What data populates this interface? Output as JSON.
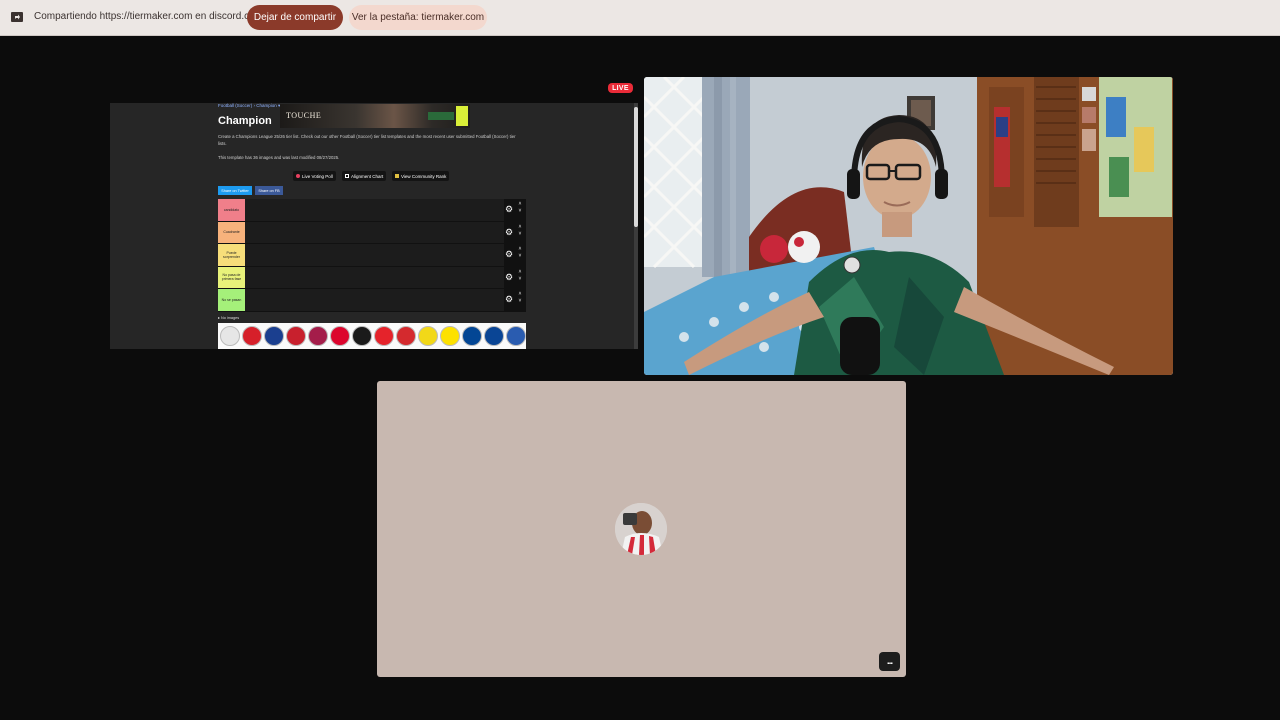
{
  "share_bar": {
    "text": "Compartiendo https://tiermaker.com en discord.com",
    "stop_label": "Dejar de compartir",
    "view_tab_label": "Ver la pestaña: tiermaker.com"
  },
  "live_badge": "LIVE",
  "screen": {
    "breadcrumb": "Football (Soccer) › Champion ▾",
    "title": "Champion",
    "ad_brand": "TOUCHE",
    "description": "Create a Champions League 25/26 tier list. Check out our other Football (Soccer) tier list templates and the most recent user submitted Football (Soccer) tier lists.",
    "template_info": "This template has 36 images and was last modified 08/27/2025.",
    "toolbar": [
      {
        "label": "Live Voting Poll",
        "icon": "poll-icon",
        "color": "#e84060"
      },
      {
        "label": "Alignment Chart",
        "icon": "grid-icon",
        "color": "#ffffff"
      },
      {
        "label": "View Community Rank",
        "icon": "rank-icon",
        "color": "#e0c040"
      }
    ],
    "share_twitter": "Share on Twitter",
    "share_fb": "Share on FB",
    "tiers": [
      {
        "label": "candidato",
        "color": "#f07f8a"
      },
      {
        "label": "Cuadrante",
        "color": "#f7b27c"
      },
      {
        "label": "Puede sorprender",
        "color": "#f7de7a"
      },
      {
        "label": "No pasa de primera fase",
        "color": "#e8f27a"
      },
      {
        "label": "No se pasan",
        "color": "#a5f07a"
      }
    ],
    "images_label": "▸ No images",
    "logos": [
      {
        "name": "ajax-logo",
        "color": "#e6e6e6",
        "text": ""
      },
      {
        "name": "arsenal-logo",
        "color": "#d6202a",
        "text": ""
      },
      {
        "name": "atalanta-logo",
        "color": "#1b3f8f",
        "text": ""
      },
      {
        "name": "atletico-logo",
        "color": "#c8202d",
        "text": ""
      },
      {
        "name": "barcelona-logo",
        "color": "#a41d4a",
        "text": ""
      },
      {
        "name": "bayern-logo",
        "color": "#dc052d",
        "text": ""
      },
      {
        "name": "leverkusen-logo",
        "color": "#1a1a1a",
        "text": ""
      },
      {
        "name": "benfica-logo",
        "color": "#e5232b",
        "text": ""
      },
      {
        "name": "bilbao-logo",
        "color": "#d42a2e",
        "text": ""
      },
      {
        "name": "bodo-logo",
        "color": "#f2d818",
        "text": ""
      },
      {
        "name": "dortmund-logo",
        "color": "#fde100",
        "text": ""
      },
      {
        "name": "chelsea-logo",
        "color": "#034694",
        "text": ""
      },
      {
        "name": "brugge-logo",
        "color": "#0a4595",
        "text": ""
      },
      {
        "name": "copenhagen-logo",
        "color": "#2a5cb0",
        "text": ""
      }
    ]
  },
  "voice_tile": {
    "more_label": "..."
  }
}
